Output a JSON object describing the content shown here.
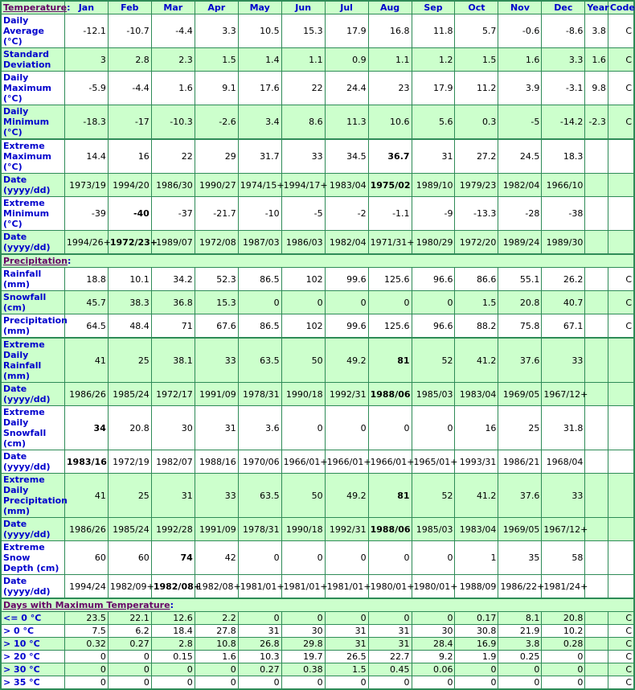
{
  "header": {
    "section_title": "Temperature",
    "months": [
      "Jan",
      "Feb",
      "Mar",
      "Apr",
      "May",
      "Jun",
      "Jul",
      "Aug",
      "Sep",
      "Oct",
      "Nov",
      "Dec"
    ],
    "year_label": "Year",
    "code_label": "Code"
  },
  "colors": {
    "border": "#2e8b57",
    "shade": "#ccffcc",
    "label_text": "#0000cc",
    "section_link": "#660066"
  },
  "temperature": [
    {
      "label": "Daily Average (°C)",
      "values": [
        "-12.1",
        "-10.7",
        "-4.4",
        "3.3",
        "10.5",
        "15.3",
        "17.9",
        "16.8",
        "11.8",
        "5.7",
        "-0.6",
        "-8.6"
      ],
      "year": "3.8",
      "code": "C",
      "bold": []
    },
    {
      "label": "Standard Deviation",
      "values": [
        "3",
        "2.8",
        "2.3",
        "1.5",
        "1.4",
        "1.1",
        "0.9",
        "1.1",
        "1.2",
        "1.5",
        "1.6",
        "3.3"
      ],
      "year": "1.6",
      "code": "C",
      "bold": []
    },
    {
      "label": "Daily Maximum (°C)",
      "values": [
        "-5.9",
        "-4.4",
        "1.6",
        "9.1",
        "17.6",
        "22",
        "24.4",
        "23",
        "17.9",
        "11.2",
        "3.9",
        "-3.1"
      ],
      "year": "9.8",
      "code": "C",
      "bold": []
    },
    {
      "label": "Daily Minimum (°C)",
      "values": [
        "-18.3",
        "-17",
        "-10.3",
        "-2.6",
        "3.4",
        "8.6",
        "11.3",
        "10.6",
        "5.6",
        "0.3",
        "-5",
        "-14.2"
      ],
      "year": "-2.3",
      "code": "C",
      "bold": []
    },
    {
      "label": "Extreme Maximum (°C)",
      "values": [
        "14.4",
        "16",
        "22",
        "29",
        "31.7",
        "33",
        "34.5",
        "36.7",
        "31",
        "27.2",
        "24.5",
        "18.3"
      ],
      "year": "",
      "code": "",
      "bold": [
        7
      ]
    },
    {
      "label": "Date (yyyy/dd)",
      "values": [
        "1973/19",
        "1994/20",
        "1986/30",
        "1990/27",
        "1974/15+",
        "1994/17+",
        "1983/04",
        "1975/02",
        "1989/10",
        "1979/23",
        "1982/04",
        "1966/10"
      ],
      "year": "",
      "code": "",
      "bold": [
        7
      ]
    },
    {
      "label": "Extreme Minimum (°C)",
      "values": [
        "-39",
        "-40",
        "-37",
        "-21.7",
        "-10",
        "-5",
        "-2",
        "-1.1",
        "-9",
        "-13.3",
        "-28",
        "-38"
      ],
      "year": "",
      "code": "",
      "bold": [
        1
      ]
    },
    {
      "label": "Date (yyyy/dd)",
      "values": [
        "1994/26+",
        "1972/23+",
        "1989/07",
        "1972/08",
        "1987/03",
        "1986/03",
        "1982/04",
        "1971/31+",
        "1980/29",
        "1972/20",
        "1989/24",
        "1989/30"
      ],
      "year": "",
      "code": "",
      "bold": [
        1
      ]
    }
  ],
  "precipitation": {
    "section_title": "Precipitation",
    "rows": [
      {
        "label": "Rainfall (mm)",
        "values": [
          "18.8",
          "10.1",
          "34.2",
          "52.3",
          "86.5",
          "102",
          "99.6",
          "125.6",
          "96.6",
          "86.6",
          "55.1",
          "26.2"
        ],
        "year": "",
        "code": "C",
        "bold": []
      },
      {
        "label": "Snowfall (cm)",
        "values": [
          "45.7",
          "38.3",
          "36.8",
          "15.3",
          "0",
          "0",
          "0",
          "0",
          "0",
          "1.5",
          "20.8",
          "40.7"
        ],
        "year": "",
        "code": "C",
        "bold": []
      },
      {
        "label": "Precipitation (mm)",
        "values": [
          "64.5",
          "48.4",
          "71",
          "67.6",
          "86.5",
          "102",
          "99.6",
          "125.6",
          "96.6",
          "88.2",
          "75.8",
          "67.1"
        ],
        "year": "",
        "code": "C",
        "bold": []
      },
      {
        "label": "Extreme Daily Rainfall (mm)",
        "values": [
          "41",
          "25",
          "38.1",
          "33",
          "63.5",
          "50",
          "49.2",
          "81",
          "52",
          "41.2",
          "37.6",
          "33"
        ],
        "year": "",
        "code": "",
        "bold": [
          7
        ]
      },
      {
        "label": "Date (yyyy/dd)",
        "values": [
          "1986/26",
          "1985/24",
          "1972/17",
          "1991/09",
          "1978/31",
          "1990/18",
          "1992/31",
          "1988/06",
          "1985/03",
          "1983/04",
          "1969/05",
          "1967/12+"
        ],
        "year": "",
        "code": "",
        "bold": [
          7
        ]
      },
      {
        "label": "Extreme Daily Snowfall (cm)",
        "values": [
          "34",
          "20.8",
          "30",
          "31",
          "3.6",
          "0",
          "0",
          "0",
          "0",
          "16",
          "25",
          "31.8"
        ],
        "year": "",
        "code": "",
        "bold": [
          0
        ]
      },
      {
        "label": "Date (yyyy/dd)",
        "values": [
          "1983/16",
          "1972/19",
          "1982/07",
          "1988/16",
          "1970/06",
          "1966/01+",
          "1966/01+",
          "1966/01+",
          "1965/01+",
          "1993/31",
          "1986/21",
          "1968/04"
        ],
        "year": "",
        "code": "",
        "bold": [
          0
        ]
      },
      {
        "label": "Extreme Daily Precipitation (mm)",
        "values": [
          "41",
          "25",
          "31",
          "33",
          "63.5",
          "50",
          "49.2",
          "81",
          "52",
          "41.2",
          "37.6",
          "33"
        ],
        "year": "",
        "code": "",
        "bold": [
          7
        ]
      },
      {
        "label": "Date (yyyy/dd)",
        "values": [
          "1986/26",
          "1985/24",
          "1992/28",
          "1991/09",
          "1978/31",
          "1990/18",
          "1992/31",
          "1988/06",
          "1985/03",
          "1983/04",
          "1969/05",
          "1967/12+"
        ],
        "year": "",
        "code": "",
        "bold": [
          7
        ]
      },
      {
        "label": "Extreme Snow Depth (cm)",
        "values": [
          "60",
          "60",
          "74",
          "42",
          "0",
          "0",
          "0",
          "0",
          "0",
          "1",
          "35",
          "58"
        ],
        "year": "",
        "code": "",
        "bold": [
          2
        ]
      },
      {
        "label": "Date (yyyy/dd)",
        "values": [
          "1994/24",
          "1982/09+",
          "1982/08+",
          "1982/08+",
          "1981/01+",
          "1981/01+",
          "1981/01+",
          "1980/01+",
          "1980/01+",
          "1988/09",
          "1986/22+",
          "1981/24+"
        ],
        "year": "",
        "code": "",
        "bold": [
          2
        ]
      }
    ]
  },
  "days_max_temp": {
    "section_title": "Days with Maximum Temperature",
    "rows": [
      {
        "label": "<= 0 °C",
        "values": [
          "23.5",
          "22.1",
          "12.6",
          "2.2",
          "0",
          "0",
          "0",
          "0",
          "0",
          "0.17",
          "8.1",
          "20.8"
        ],
        "year": "",
        "code": "C",
        "bold": []
      },
      {
        "label": "> 0 °C",
        "values": [
          "7.5",
          "6.2",
          "18.4",
          "27.8",
          "31",
          "30",
          "31",
          "31",
          "30",
          "30.8",
          "21.9",
          "10.2"
        ],
        "year": "",
        "code": "C",
        "bold": []
      },
      {
        "label": "> 10 °C",
        "values": [
          "0.32",
          "0.27",
          "2.8",
          "10.8",
          "26.8",
          "29.8",
          "31",
          "31",
          "28.4",
          "16.9",
          "3.8",
          "0.28"
        ],
        "year": "",
        "code": "C",
        "bold": []
      },
      {
        "label": "> 20 °C",
        "values": [
          "0",
          "0",
          "0.15",
          "1.6",
          "10.3",
          "19.7",
          "26.5",
          "22.7",
          "9.2",
          "1.9",
          "0.25",
          "0"
        ],
        "year": "",
        "code": "C",
        "bold": []
      },
      {
        "label": "> 30 °C",
        "values": [
          "0",
          "0",
          "0",
          "0",
          "0.27",
          "0.38",
          "1.5",
          "0.45",
          "0.06",
          "0",
          "0",
          "0"
        ],
        "year": "",
        "code": "C",
        "bold": []
      },
      {
        "label": "> 35 °C",
        "values": [
          "0",
          "0",
          "0",
          "0",
          "0",
          "0",
          "0",
          "0",
          "0",
          "0",
          "0",
          "0"
        ],
        "year": "",
        "code": "C",
        "bold": []
      }
    ]
  }
}
